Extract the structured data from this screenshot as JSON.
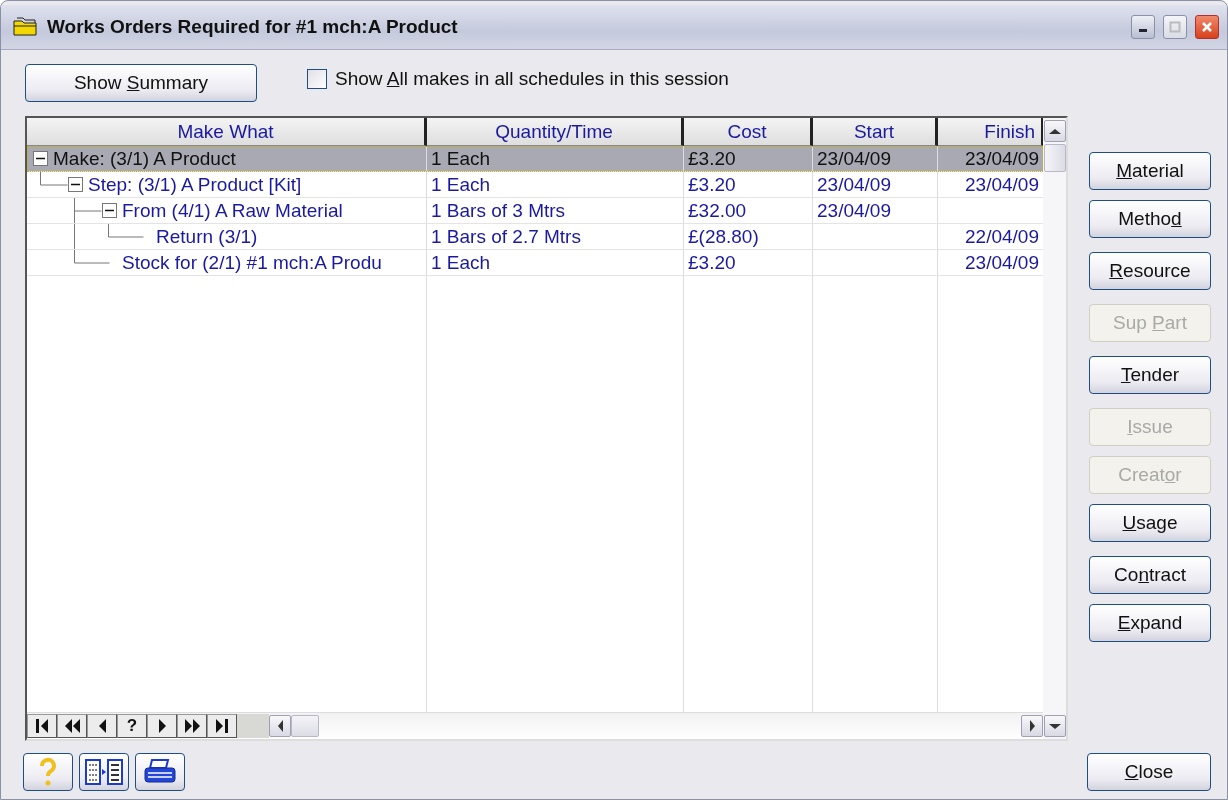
{
  "window": {
    "title": "Works Orders Required for #1 mch:A Product"
  },
  "toolbar": {
    "summary_button": {
      "before": "Show ",
      "mnemonic": "S",
      "after": "ummary"
    },
    "show_all": {
      "before": "Show ",
      "mnemonic": "A",
      "after": "ll makes in all schedules in this session",
      "checked": false
    }
  },
  "table": {
    "columns": [
      {
        "label": "Make What"
      },
      {
        "label": "Quantity/Time"
      },
      {
        "label": "Cost"
      },
      {
        "label": "Start"
      },
      {
        "label": "Finish"
      }
    ],
    "rows": [
      {
        "label": "Make: (3/1) A Product",
        "quantity": "1 Each",
        "cost": "£3.20",
        "start": "23/04/09",
        "finish": "23/04/09",
        "selected": true,
        "expanded": true,
        "children": [
          {
            "label": "Step: (3/1) A Product [Kit]",
            "quantity": "1 Each",
            "cost": "£3.20",
            "start": "23/04/09",
            "finish": "23/04/09",
            "selected": false,
            "expanded": true,
            "children": [
              {
                "label": "From (4/1) A Raw Material",
                "quantity": "1 Bars of 3 Mtrs",
                "cost": "£32.00",
                "start": "23/04/09",
                "selected": false,
                "expanded": true,
                "children": [
                  {
                    "label": "Return (3/1)",
                    "quantity": "1 Bars of 2.7 Mtrs",
                    "cost": "£(28.80)",
                    "finish": "22/04/09",
                    "selected": false
                  }
                ]
              },
              {
                "label": "Stock for (2/1) #1 mch:A Produ",
                "quantity": "1 Each",
                "cost": "£3.20",
                "finish": "23/04/09",
                "selected": false
              }
            ]
          }
        ]
      }
    ],
    "record_nav": {
      "help_label": "?"
    }
  },
  "side_buttons": [
    [
      {
        "mnemonic": "M",
        "after": "aterial",
        "disabled": false
      },
      {
        "before": "Metho",
        "mnemonic": "d",
        "disabled": false
      }
    ],
    [
      {
        "mnemonic": "R",
        "after": "esource",
        "disabled": false
      }
    ],
    [
      {
        "before": "Sup ",
        "mnemonic": "P",
        "after": "art",
        "disabled": true
      }
    ],
    [
      {
        "mnemonic": "T",
        "after": "ender",
        "disabled": false
      }
    ],
    [
      {
        "mnemonic": "I",
        "after": "ssue",
        "disabled": true
      },
      {
        "before": "Creat",
        "mnemonic": "o",
        "after": "r",
        "disabled": true
      },
      {
        "mnemonic": "U",
        "after": "sage",
        "disabled": false
      }
    ],
    [
      {
        "before": "Co",
        "mnemonic": "n",
        "after": "tract",
        "disabled": false
      },
      {
        "mnemonic": "E",
        "after": "xpand",
        "disabled": false
      }
    ]
  ],
  "close_button": {
    "mnemonic": "C",
    "after": "lose"
  }
}
